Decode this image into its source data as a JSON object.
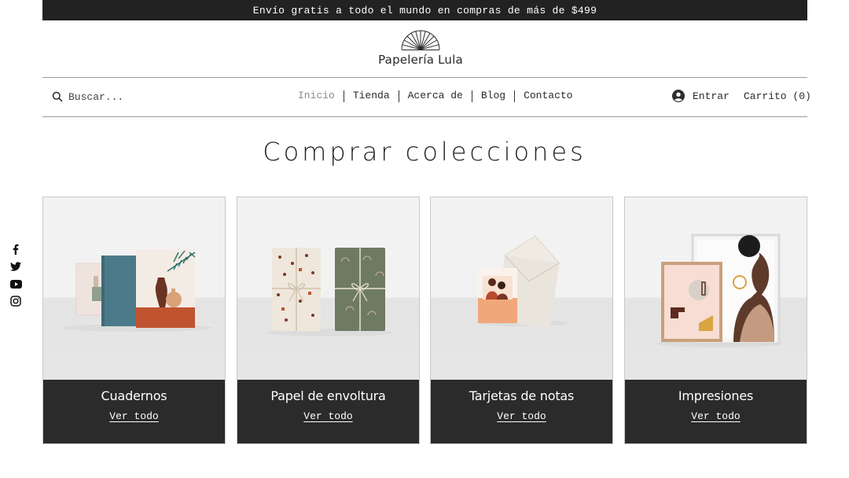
{
  "promo": {
    "text": "Envío gratis a todo el mundo en compras de más de $499"
  },
  "brand": {
    "name": "Papelería Lula",
    "logo_icon": "sunrise-lines-icon"
  },
  "search": {
    "placeholder": "Buscar...",
    "icon": "search-icon"
  },
  "nav": {
    "items": [
      {
        "label": "Inicio",
        "active": true
      },
      {
        "label": "Tienda"
      },
      {
        "label": "Acerca de"
      },
      {
        "label": "Blog"
      },
      {
        "label": "Contacto"
      }
    ]
  },
  "account": {
    "login_label": "Entrar",
    "icon": "user-avatar-icon",
    "cart_label": "Carrito (0)"
  },
  "page": {
    "title": "Comprar colecciones"
  },
  "social": [
    "facebook-icon",
    "twitter-icon",
    "youtube-icon",
    "instagram-icon"
  ],
  "collections": [
    {
      "title": "Cuadernos",
      "link": "Ver todo"
    },
    {
      "title": "Papel de envoltura",
      "link": "Ver todo"
    },
    {
      "title": "Tarjetas de notas",
      "link": "Ver todo"
    },
    {
      "title": "Impresiones",
      "link": "Ver todo"
    }
  ],
  "colors": {
    "dark": "#2b2b2b",
    "accent_terracotta": "#c0532f",
    "accent_olive": "#6f7a62"
  }
}
